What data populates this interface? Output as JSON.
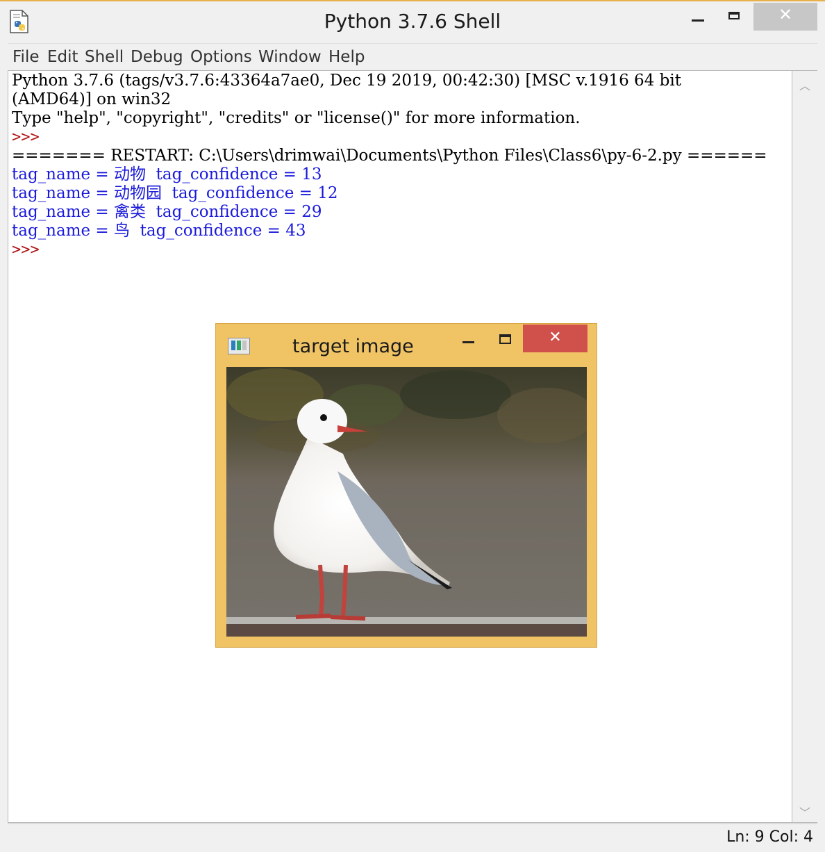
{
  "window": {
    "title": "Python 3.7.6 Shell",
    "close_glyph": "✕"
  },
  "menu": [
    "File",
    "Edit",
    "Shell",
    "Debug",
    "Options",
    "Window",
    "Help"
  ],
  "shell": {
    "banner_line1": "Python 3.7.6 (tags/v3.7.6:43364a7ae0, Dec 19 2019, 00:42:30) [MSC v.1916 64 bit",
    "banner_line2": "(AMD64)] on win32",
    "banner_line3": "Type \"help\", \"copyright\", \"credits\" or \"license()\" for more information.",
    "prompt": ">>>",
    "restart_line": "======= RESTART: C:\\Users\\drimwai\\Documents\\Python Files\\Class6\\py-6-2.py ======",
    "output": [
      "tag_name = 动物  tag_confidence = 13",
      "tag_name = 动物园  tag_confidence = 12",
      "tag_name = 禽类  tag_confidence = 29",
      "tag_name = 鸟  tag_confidence = 43"
    ]
  },
  "status": {
    "text": "Ln: 9  Col: 4"
  },
  "image_window": {
    "title": "target image",
    "close_glyph": "✕",
    "photo_subject": "seagull"
  },
  "colors": {
    "output_text": "#1a1adb",
    "prompt": "#b01414",
    "image_window_frame": "#f0c465",
    "image_window_close": "#d0514c"
  },
  "icons": [
    "python-file-icon",
    "minimize-icon",
    "maximize-icon",
    "close-icon",
    "scroll-up-icon",
    "scroll-down-icon",
    "tk-app-icon"
  ]
}
